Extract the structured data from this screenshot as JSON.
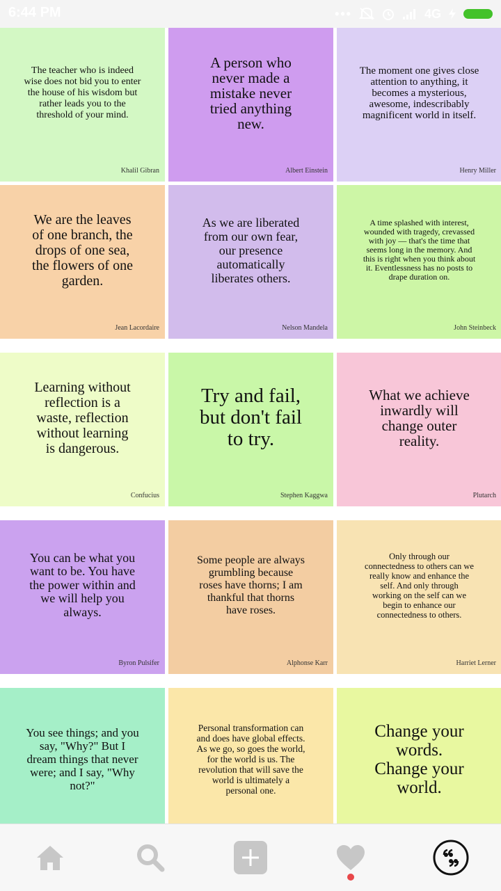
{
  "status_bar": {
    "time": "6:44 PM",
    "network": "4G",
    "battery_color": "#43c22a"
  },
  "quotes": [
    {
      "text": "The teacher who is indeed wise does not bid you to enter the house of his wisdom but rather leads you to the threshold of your mind.",
      "author": "Khalil Gibran",
      "bg": "#d3f8c4"
    },
    {
      "text": "A person who never made a mistake never tried anything new.",
      "author": "Albert Einstein",
      "bg": "#cf9cef"
    },
    {
      "text": "The moment one gives close attention to anything, it becomes a mysterious, awesome, indescribably magnificent world in itself.",
      "author": "Henry Miller",
      "bg": "#dcd0f5"
    },
    {
      "text": "We are the leaves of one branch, the drops of one sea, the flowers of one garden.",
      "author": "Jean Lacordaire",
      "bg": "#f8d2a8"
    },
    {
      "text": "As we are liberated from our own fear, our presence automatically liberates others.",
      "author": "Nelson Mandela",
      "bg": "#d2bcec"
    },
    {
      "text": "A time splashed with interest, wounded with tragedy, crevassed with joy — that's the time that seems long in the memory. And this is right when you think about it. Eventlessness has no posts to drape duration on.",
      "author": "John Steinbeck",
      "bg": "#cdf6a6"
    },
    {
      "text": "Learning without reflection is a waste, reflection without learning is dangerous.",
      "author": "Confucius",
      "bg": "#eefcc8"
    },
    {
      "text": "Try and fail, but don't fail to try.",
      "author": "Stephen Kaggwa",
      "bg": "#c9f7a8"
    },
    {
      "text": "What we achieve inwardly will change outer reality.",
      "author": "Plutarch",
      "bg": "#f8c6d8"
    },
    {
      "text": "You can be what you want to be. You have the power within and we will help you always.",
      "author": "Byron Pulsifer",
      "bg": "#cba2ef"
    },
    {
      "text": "Some people are always grumbling because roses have thorns; I am thankful that thorns have roses.",
      "author": "Alphonse Karr",
      "bg": "#f3cda2"
    },
    {
      "text": "Only through our connectedness to others can we really know and enhance the self. And only through working on the self can we begin to enhance our connectedness to others.",
      "author": "Harriet Lerner",
      "bg": "#f8e3b3"
    },
    {
      "text": "You see things; and you say, \"Why?\" But I dream things that never were; and I say, \"Why not?\"",
      "author": "",
      "bg": "#a5efc8"
    },
    {
      "text": "Personal transformation can and does have global effects. As we go, so goes the world, for the world is us. The revolution that will save the world is ultimately a personal one.",
      "author": "",
      "bg": "#fbe7a9"
    },
    {
      "text": "Change your words. Change your world.",
      "author": "",
      "bg": "#e8f8a0"
    }
  ],
  "bottom_nav": [
    {
      "icon": "home-icon"
    },
    {
      "icon": "search-icon"
    },
    {
      "icon": "add-icon"
    },
    {
      "icon": "heart-icon"
    },
    {
      "icon": "quote-icon"
    }
  ]
}
